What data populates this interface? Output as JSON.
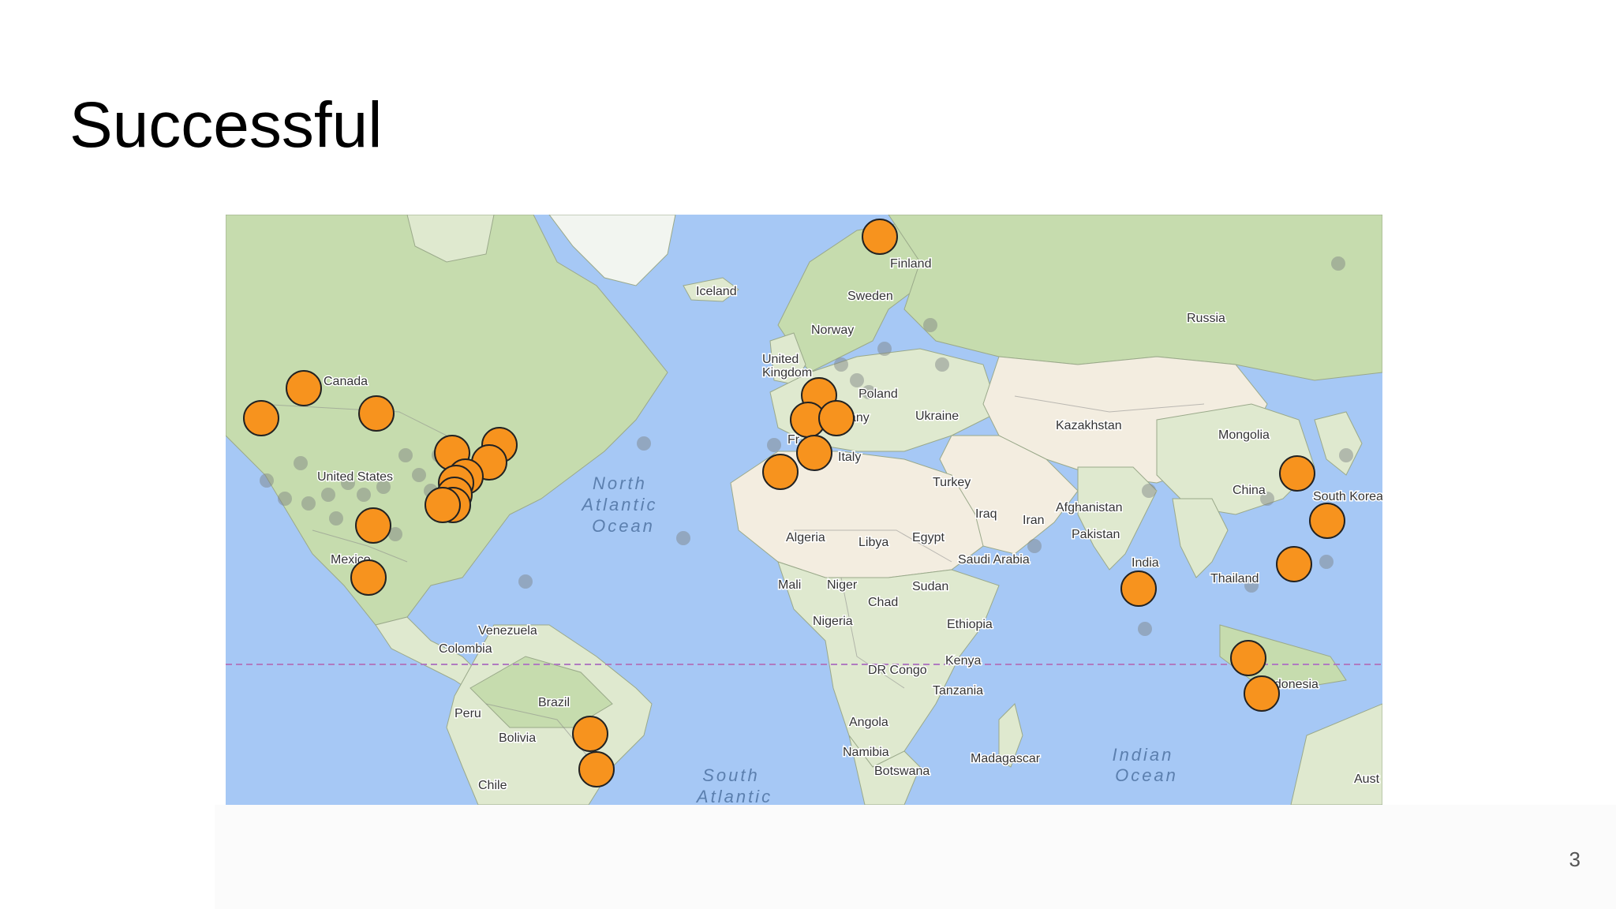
{
  "slide": {
    "title": "Successful",
    "page_number": "3"
  },
  "map": {
    "country_labels": [
      {
        "id": "canada",
        "text": "Canada"
      },
      {
        "id": "united-states",
        "text": "United States"
      },
      {
        "id": "mexico",
        "text": "Mexico"
      },
      {
        "id": "venezuela",
        "text": "Venezuela"
      },
      {
        "id": "colombia",
        "text": "Colombia"
      },
      {
        "id": "brazil",
        "text": "Brazil"
      },
      {
        "id": "peru",
        "text": "Peru"
      },
      {
        "id": "bolivia",
        "text": "Bolivia"
      },
      {
        "id": "chile",
        "text": "Chile"
      },
      {
        "id": "iceland",
        "text": "Iceland"
      },
      {
        "id": "finland",
        "text": "Finland"
      },
      {
        "id": "sweden",
        "text": "Sweden"
      },
      {
        "id": "norway",
        "text": "Norway"
      },
      {
        "id": "united-kingdom",
        "text": "United\nKingdom"
      },
      {
        "id": "poland",
        "text": "Poland"
      },
      {
        "id": "germany",
        "text": "any"
      },
      {
        "id": "france",
        "text": "Fr"
      },
      {
        "id": "ukraine",
        "text": "Ukraine"
      },
      {
        "id": "italy",
        "text": "Italy"
      },
      {
        "id": "russia",
        "text": "Russia"
      },
      {
        "id": "kazakhstan",
        "text": "Kazakhstan"
      },
      {
        "id": "mongolia",
        "text": "Mongolia"
      },
      {
        "id": "turkey",
        "text": "Turkey"
      },
      {
        "id": "iraq",
        "text": "Iraq"
      },
      {
        "id": "iran",
        "text": "Iran"
      },
      {
        "id": "afghanistan",
        "text": "Afghanistan"
      },
      {
        "id": "pakistan",
        "text": "Pakistan"
      },
      {
        "id": "china",
        "text": "China"
      },
      {
        "id": "south-korea",
        "text": "South Korea"
      },
      {
        "id": "india",
        "text": "India"
      },
      {
        "id": "thailand",
        "text": "Thailand"
      },
      {
        "id": "indonesia",
        "text": "ndonesia"
      },
      {
        "id": "algeria",
        "text": "Algeria"
      },
      {
        "id": "libya",
        "text": "Libya"
      },
      {
        "id": "egypt",
        "text": "Egypt"
      },
      {
        "id": "saudi-arabia",
        "text": "Saudi Arabia"
      },
      {
        "id": "mali",
        "text": "Mali"
      },
      {
        "id": "niger",
        "text": "Niger"
      },
      {
        "id": "chad",
        "text": "Chad"
      },
      {
        "id": "sudan",
        "text": "Sudan"
      },
      {
        "id": "nigeria",
        "text": "Nigeria"
      },
      {
        "id": "ethiopia",
        "text": "Ethiopia"
      },
      {
        "id": "kenya",
        "text": "Kenya"
      },
      {
        "id": "dr-congo",
        "text": "DR Congo"
      },
      {
        "id": "tanzania",
        "text": "Tanzania"
      },
      {
        "id": "angola",
        "text": "Angola"
      },
      {
        "id": "namibia",
        "text": "Namibia"
      },
      {
        "id": "botswana",
        "text": "Botswana"
      },
      {
        "id": "madagascar",
        "text": "Madagascar"
      },
      {
        "id": "australia",
        "text": "Aust"
      }
    ],
    "ocean_labels": [
      {
        "id": "north-atlantic",
        "lines": [
          "North",
          "Atlantic",
          "Ocean"
        ]
      },
      {
        "id": "south-atlantic",
        "lines": [
          "South",
          "Atlantic"
        ]
      },
      {
        "id": "indian-ocean",
        "lines": [
          "Indian",
          "Ocean"
        ]
      }
    ],
    "marker_color": "#f7931e",
    "successful_marker_count": 27
  }
}
